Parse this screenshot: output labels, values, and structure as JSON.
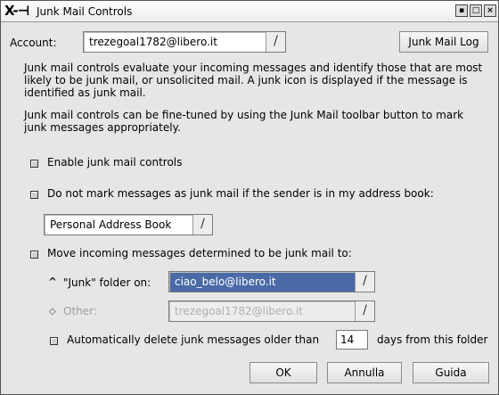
{
  "window": {
    "title": "Junk Mail Controls",
    "logo": "X-⊣",
    "buttons": [
      "minimize-icon",
      "maximize-icon",
      "close-icon"
    ]
  },
  "account": {
    "label": "Account:",
    "value": "trezegoal1782@libero.it",
    "log_button": "Junk Mail Log"
  },
  "intro": {
    "p1": "Junk mail controls evaluate your incoming messages and identify those that are most likely to be junk mail, or unsolicited mail. A junk icon is displayed if the message is identified as junk mail.",
    "p2": "Junk mail controls can be fine-tuned by using the Junk Mail toolbar button to mark junk messages appropriately."
  },
  "options": {
    "enable": "Enable junk mail controls",
    "whitelist": "Do not mark messages as junk mail if the sender is in my address book:",
    "address_book": "Personal Address Book",
    "move": "Move incoming messages determined to be junk mail to:",
    "junk_folder_label": "\"Junk\" folder on:",
    "junk_folder_value": "ciao_belo@libero.it",
    "other_label": "Other:",
    "other_value": "trezegoal1782@libero.it",
    "auto_delete_pre": "Automatically delete junk messages older than",
    "auto_delete_days": "14",
    "auto_delete_post": "days from this folder"
  },
  "footer": {
    "ok": "OK",
    "cancel": "Annulla",
    "help": "Guida"
  }
}
